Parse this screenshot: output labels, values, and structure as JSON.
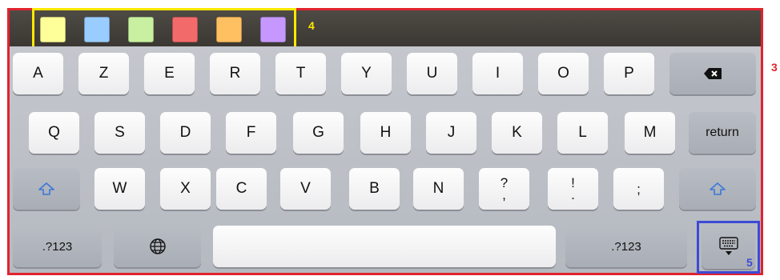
{
  "colors": {
    "red_frame": "#e0232e",
    "yellow_highlight": "#ffe800",
    "blue_highlight": "#3c4ad6",
    "swatches": [
      "#ffff99",
      "#99ccff",
      "#c8f0a0",
      "#f26a6a",
      "#ffc061",
      "#c698ff"
    ]
  },
  "markers": {
    "keyboard": "3",
    "color_toolbar": "4",
    "dismiss_key": "5"
  },
  "keyboard": {
    "row1": [
      "A",
      "Z",
      "E",
      "R",
      "T",
      "Y",
      "U",
      "I",
      "O",
      "P"
    ],
    "row2": [
      "Q",
      "S",
      "D",
      "F",
      "G",
      "H",
      "J",
      "K",
      "L",
      "M"
    ],
    "return_label": "return",
    "row3": [
      "W",
      "X",
      "C",
      "V",
      "B",
      "N"
    ],
    "punct": [
      {
        "top": "?",
        "bottom": ","
      },
      {
        "top": "!",
        "bottom": "."
      },
      {
        "top": ";",
        "bottom": ""
      }
    ],
    "numbers_left": ".?123",
    "numbers_right": ".?123"
  },
  "icons": {
    "backspace": "backspace-icon",
    "shift": "shift-icon",
    "globe": "globe-icon",
    "dismiss": "keyboard-dismiss-icon"
  }
}
